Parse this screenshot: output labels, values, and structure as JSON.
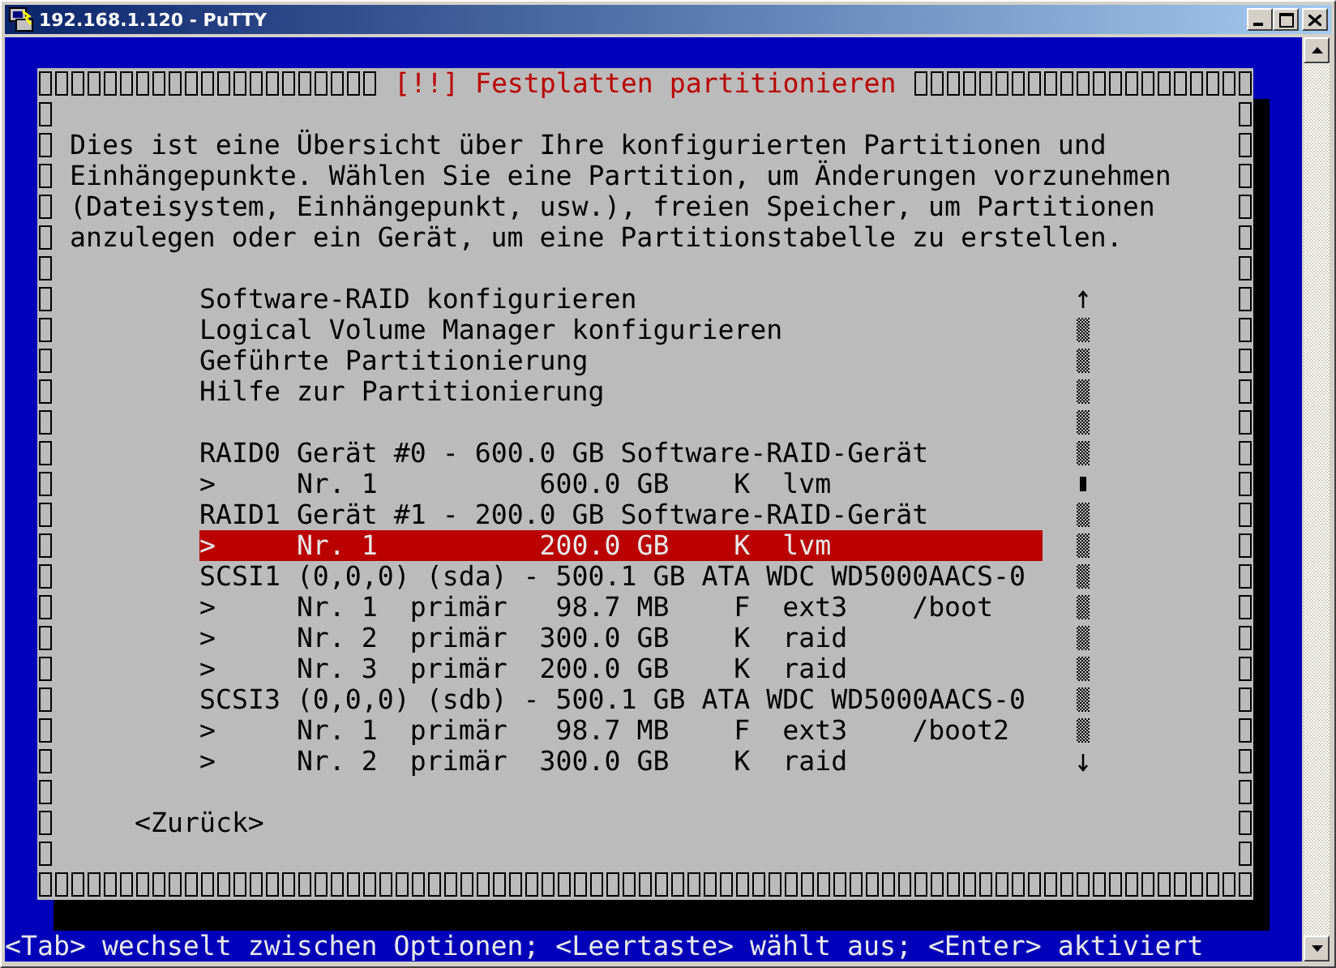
{
  "window": {
    "title": "192.168.1.120 - PuTTY"
  },
  "dialog": {
    "title": "[!!] Festplatten partitionieren",
    "description": [
      "Dies ist eine Übersicht über Ihre konfigurierten Partitionen und",
      "Einhängepunkte. Wählen Sie eine Partition, um Änderungen vorzunehmen",
      "(Dateisystem, Einhängepunkt, usw.), freien Speicher, um Partitionen",
      "anzulegen oder ein Gerät, um eine Partitionstabelle zu erstellen."
    ],
    "entries": [
      {
        "kind": "action",
        "text": "Software-RAID konfigurieren",
        "selected": false
      },
      {
        "kind": "action",
        "text": "Logical Volume Manager konfigurieren",
        "selected": false
      },
      {
        "kind": "action",
        "text": "Geführte Partitionierung",
        "selected": false
      },
      {
        "kind": "action",
        "text": "Hilfe zur Partitionierung",
        "selected": false
      },
      {
        "kind": "device",
        "text": "RAID0 Gerät #0 - 600.0 GB Software-RAID-Gerät",
        "selected": false
      },
      {
        "kind": "partition",
        "text": ">     Nr. 1          600.0 GB    K  lvm",
        "selected": false
      },
      {
        "kind": "device",
        "text": "RAID1 Gerät #1 - 200.0 GB Software-RAID-Gerät",
        "selected": false
      },
      {
        "kind": "partition",
        "text": ">     Nr. 1          200.0 GB    K  lvm",
        "selected": true
      },
      {
        "kind": "device",
        "text": "SCSI1 (0,0,0) (sda) - 500.1 GB ATA WDC WD5000AACS-0",
        "selected": false
      },
      {
        "kind": "partition",
        "text": ">     Nr. 1  primär   98.7 MB    F  ext3    /boot",
        "selected": false
      },
      {
        "kind": "partition",
        "text": ">     Nr. 2  primär  300.0 GB    K  raid",
        "selected": false
      },
      {
        "kind": "partition",
        "text": ">     Nr. 3  primär  200.0 GB    K  raid",
        "selected": false
      },
      {
        "kind": "device",
        "text": "SCSI3 (0,0,0) (sdb) - 500.1 GB ATA WDC WD5000AACS-0",
        "selected": false
      },
      {
        "kind": "partition",
        "text": ">     Nr. 1  primär   98.7 MB    F  ext3    /boot2",
        "selected": false
      },
      {
        "kind": "partition",
        "text": ">     Nr. 2  primär  300.0 GB    K  raid",
        "selected": false
      }
    ],
    "back_button": "<Zurück>"
  },
  "status_line": "<Tab> wechselt zwischen Optionen; <Leertaste> wählt aus; <Enter> aktiviert"
}
